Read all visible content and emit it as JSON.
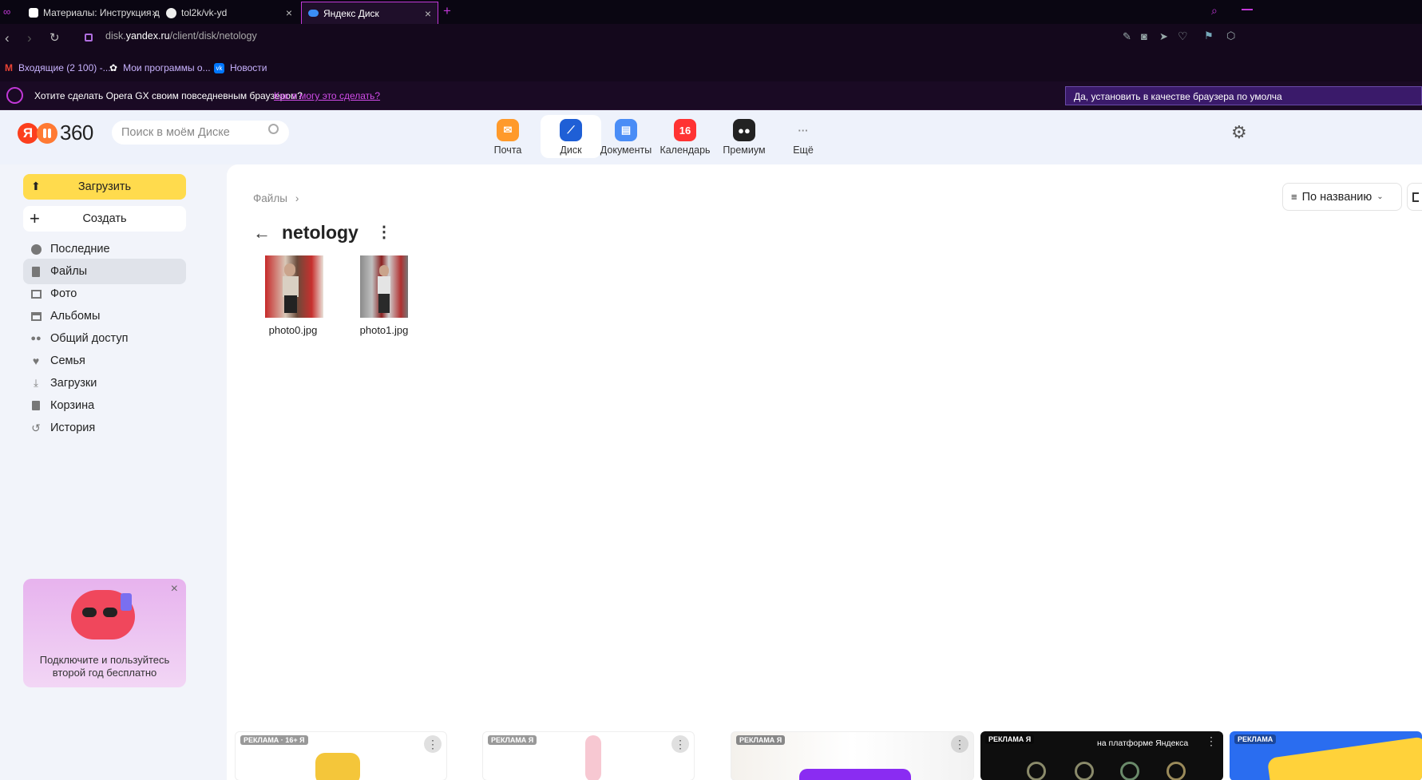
{
  "browser": {
    "tabs": [
      {
        "title": "Материалы: Инструкция д"
      },
      {
        "title": "tol2k/vk-yd"
      },
      {
        "title": "Яндекс Диск"
      }
    ],
    "new_tab": "+",
    "url_host": "disk.yandex.ru",
    "url_prefix": "disk.",
    "url_domain": "yandex.ru",
    "url_path": "/client/disk/netology",
    "bookmarks": [
      {
        "label": "Входящие (2 100) -..."
      },
      {
        "label": "Мои программы о..."
      },
      {
        "label": "Новости"
      }
    ],
    "opera_prompt": "Хотите сделать Opera GX своим повседневным браузером?",
    "opera_link": "Как я могу это сделать?",
    "opera_button": "Да, установить в качестве браузера по умолча"
  },
  "header": {
    "logo_text": "360",
    "logo_letter": "Я",
    "search_placeholder": "Поиск в моём Диске",
    "services": [
      {
        "label": "Почта"
      },
      {
        "label": "Диск"
      },
      {
        "label": "Документы"
      },
      {
        "label": "Календарь",
        "badge": "16"
      },
      {
        "label": "Премиум"
      },
      {
        "label": "Ещё"
      }
    ],
    "more_dots": "···"
  },
  "sidebar": {
    "upload": "Загрузить",
    "create": "Создать",
    "items": [
      {
        "label": "Последние"
      },
      {
        "label": "Файлы"
      },
      {
        "label": "Фото"
      },
      {
        "label": "Альбомы"
      },
      {
        "label": "Общий доступ"
      },
      {
        "label": "Семья"
      },
      {
        "label": "Загрузки"
      },
      {
        "label": "Корзина"
      },
      {
        "label": "История"
      }
    ],
    "promo_text": "Подключите и пользуйтесь второй год бесплатно",
    "promo_close": "×"
  },
  "main": {
    "breadcrumb_root": "Файлы",
    "breadcrumb_sep": "›",
    "folder_title": "netology",
    "sort_label": "По названию",
    "files": [
      {
        "name": "photo0.jpg"
      },
      {
        "name": "photo1.jpg"
      }
    ]
  },
  "ads": [
    {
      "label": "РЕКЛАМА · 16+ Я"
    },
    {
      "label": "РЕКЛАМА Я"
    },
    {
      "label": "РЕКЛАМА Я"
    },
    {
      "label": "РЕКЛАМА Я",
      "text": "на платформе Яндекса"
    },
    {
      "label": "РЕКЛАМА"
    }
  ],
  "colors": {
    "accent_yellow": "#ffdb4d",
    "opera_pink": "#c238d8",
    "brand_red": "#fc3f1d"
  }
}
